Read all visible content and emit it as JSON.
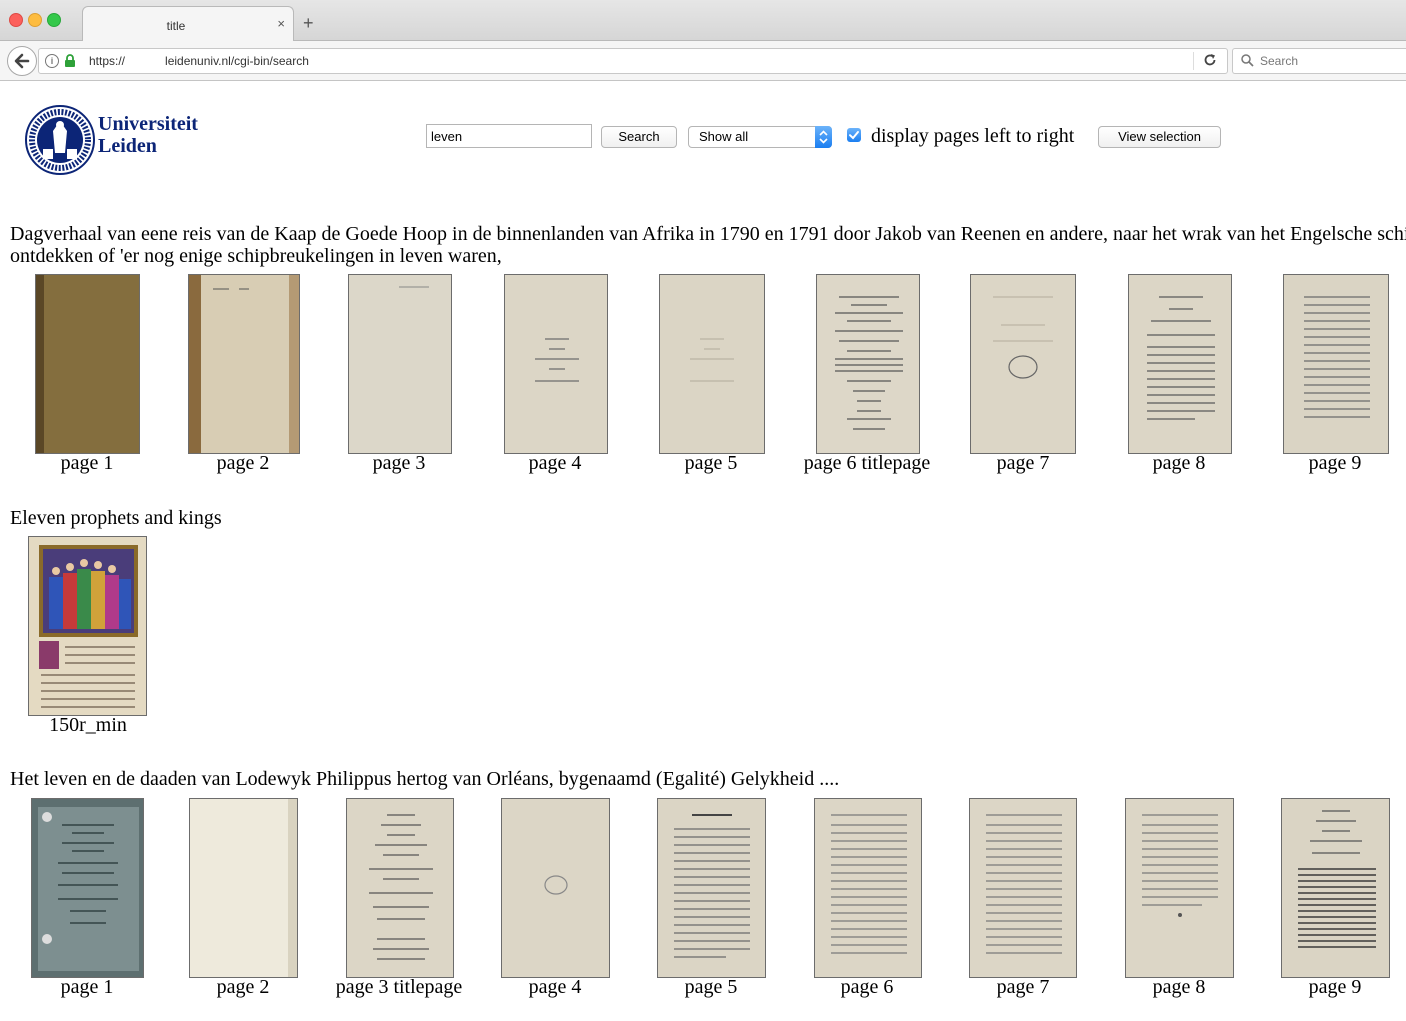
{
  "browser": {
    "tab_title": "title",
    "new_tab": "+",
    "close": "×",
    "url": "https://            leidenuniv.nl/cgi-bin/search",
    "search_placeholder": "Search"
  },
  "header": {
    "logo_line1": "Universiteit",
    "logo_line2": "Leiden",
    "query": "leven",
    "search_button": "Search",
    "filter_selected": "Show all",
    "checkbox_checked": true,
    "checkbox_label": "display pages left to right",
    "view_selection_button": "View selection"
  },
  "results": [
    {
      "title_line1": "Dagverhaal van eene reis van de Kaap de Goede Hoop in de binnenlanden van Afrika in 1790 en 1791 door Jakob van Reenen en andere, naar het wrak van het Engelsche schip",
      "title_line2": "ontdekken of 'er nog enige schipbreukelingen in leven waren,",
      "pages": [
        "page 1",
        "page 2",
        "page 3",
        "page 4",
        "page 5",
        "page 6 titlepage",
        "page 7",
        "page 8",
        "page 9"
      ]
    },
    {
      "title_line1": "Eleven prophets and kings",
      "pages": [
        "150r_min"
      ]
    },
    {
      "title_line1": "Het leven en de daaden van Lodewyk Philippus hertog van Orléans, bygenaamd (Egalité) Gelykheid ....",
      "pages": [
        "page 1",
        "page 2",
        "page 3 titlepage",
        "page 4",
        "page 5",
        "page 6",
        "page 7",
        "page 8",
        "page 9"
      ]
    }
  ],
  "colors": {
    "logo_blue": "#0c2577",
    "checkbox_blue": "#1a7ef1"
  }
}
